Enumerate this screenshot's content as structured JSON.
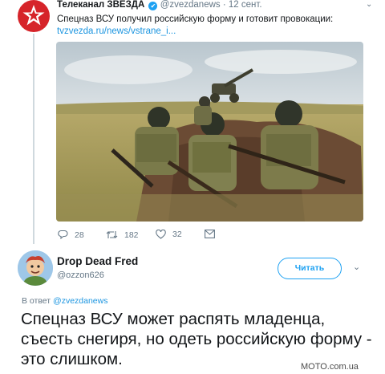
{
  "quoted_tweet": {
    "name": "Телеканал ЗВЕЗДА",
    "verified_mark": "✔",
    "handle": "@zvezdanews",
    "separator": "·",
    "date": "12 сент.",
    "text": "Спецназ ВСУ получил российскую форму и готовит провокации:",
    "link": "tvzvezda.ru/news/vstrane_i...",
    "caret": "⌄",
    "actions": {
      "replies": "28",
      "retweets": "182",
      "likes": "32"
    },
    "icons": {
      "avatar": "zvezda-star-logo",
      "reply": "reply-icon",
      "retweet": "retweet-icon",
      "like": "heart-icon",
      "dm": "envelope-icon"
    }
  },
  "reply_tweet": {
    "name": "Drop Dead Fred",
    "handle": "@ozzon626",
    "follow_label": "Читать",
    "caret": "⌄",
    "reply_prefix": "В ответ",
    "reply_handle": "@zvezdanews",
    "text": "Спецназ ВСУ может распять младенца, съесть снегиря, но одеть российскую форму - это слишком."
  },
  "watermark": "MOTO.com.ua",
  "colors": {
    "accent": "#1da1f2",
    "link": "#1b95e0",
    "muted": "#657786",
    "brand_red": "#d6242a"
  }
}
